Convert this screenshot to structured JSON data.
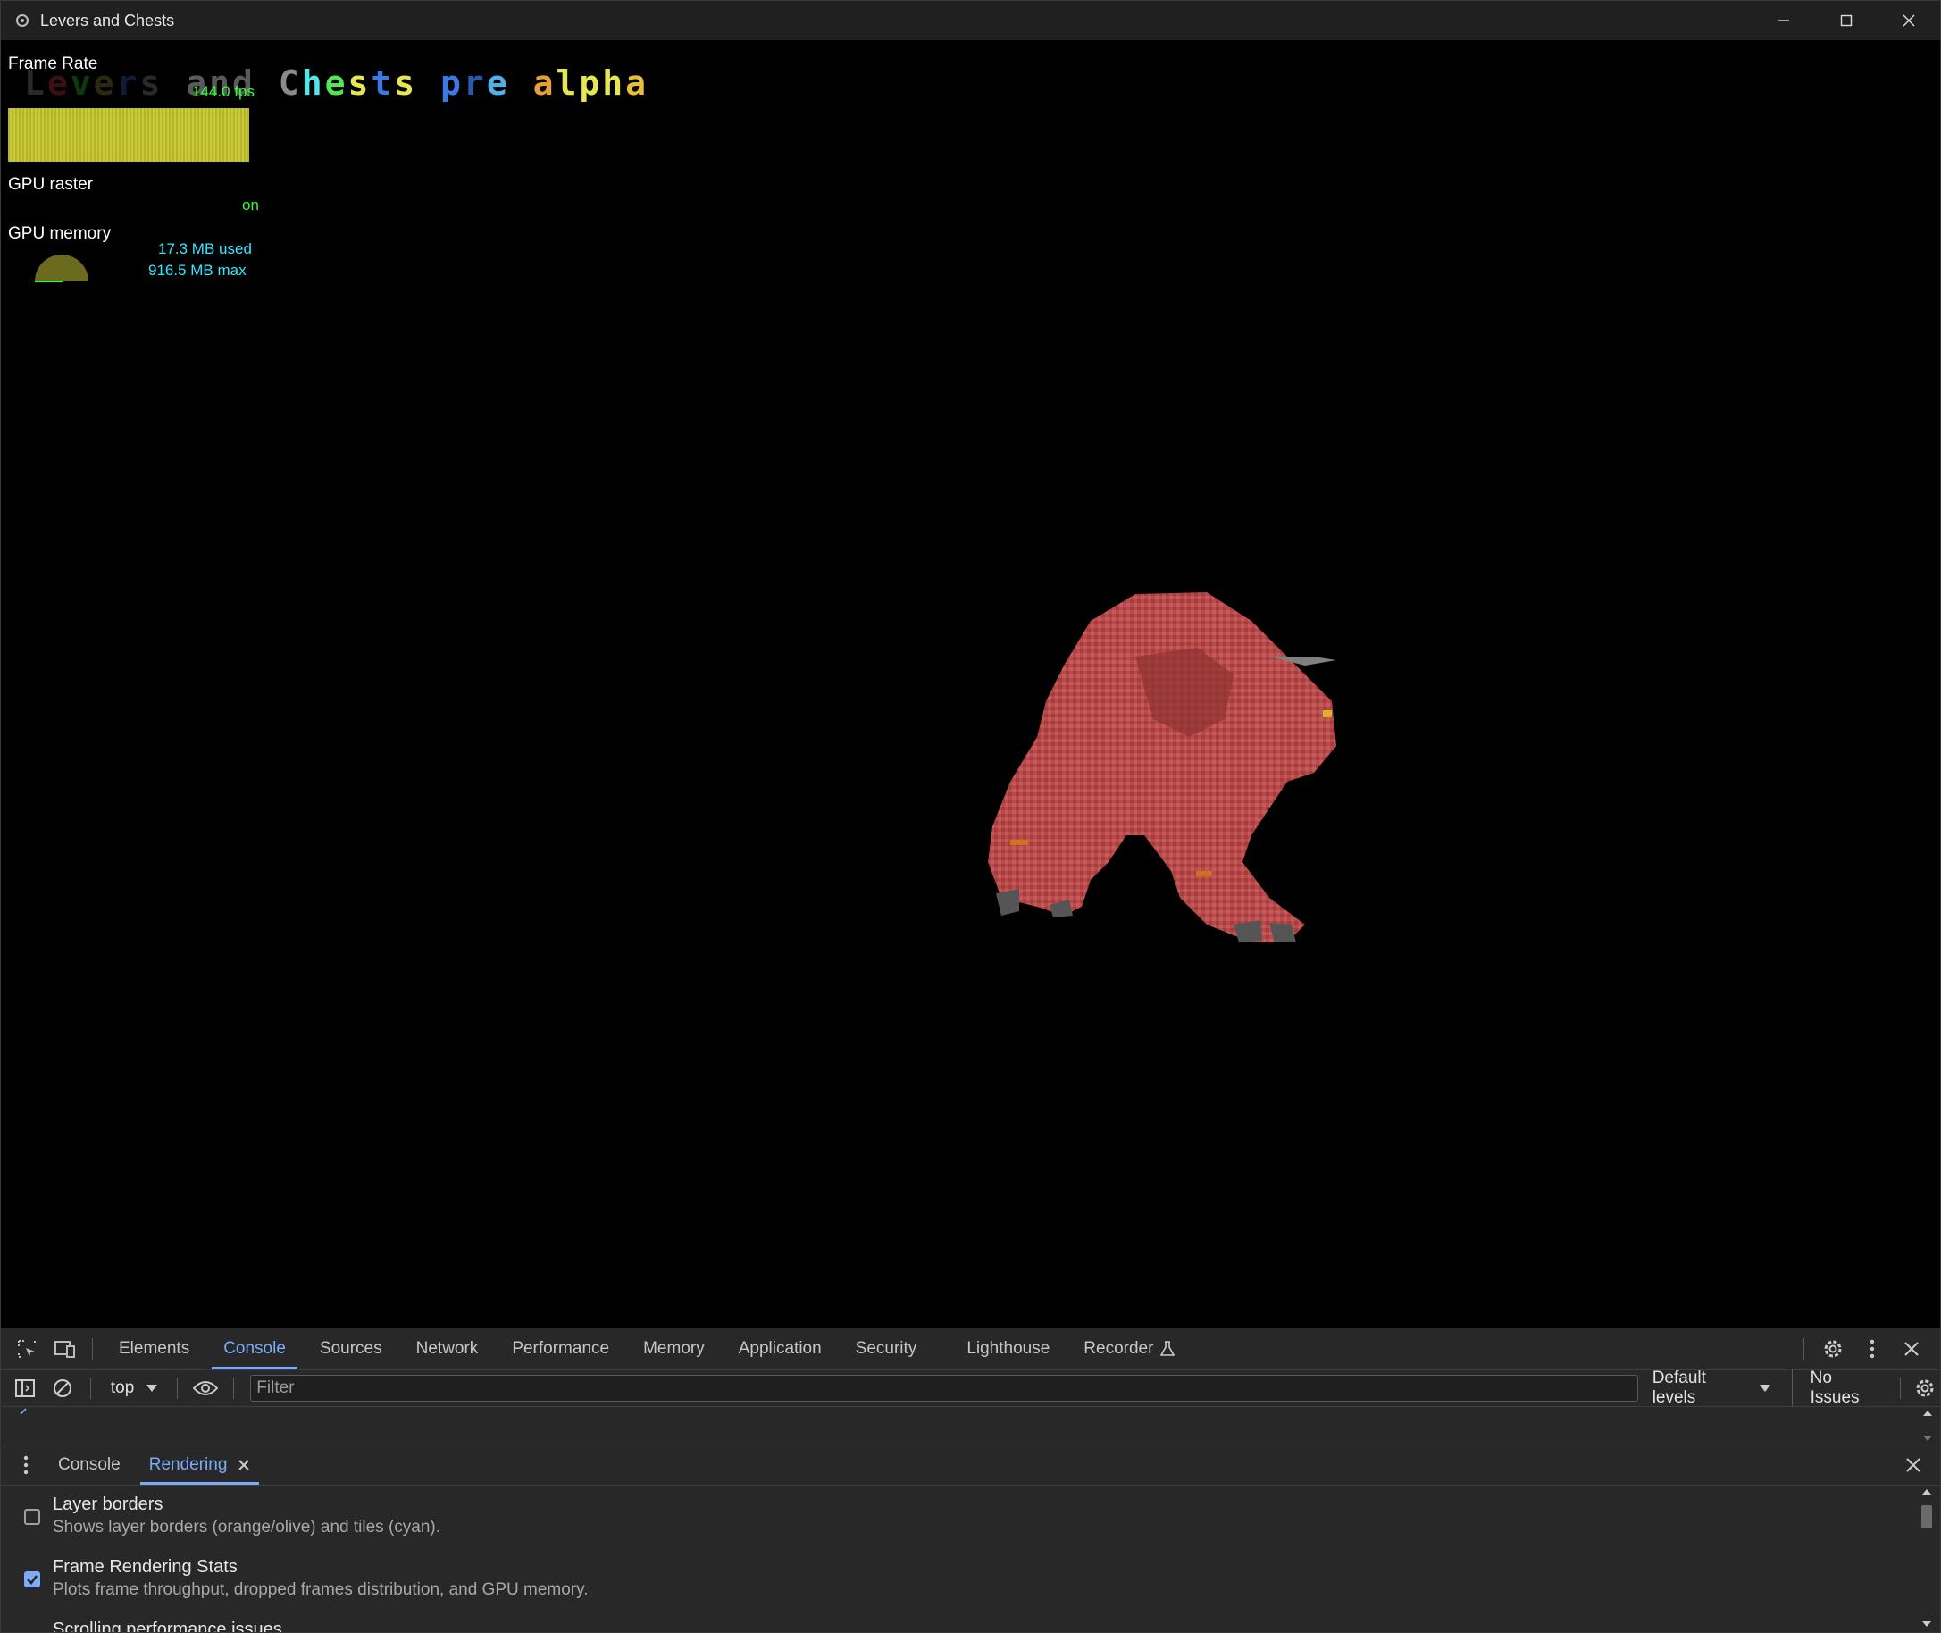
{
  "window": {
    "title": "Levers and Chests"
  },
  "hud": {
    "frame_rate_label": "Frame Rate",
    "fps": "144.0 fps",
    "gpu_raster_label": "GPU raster",
    "gpu_raster_value": "on",
    "gpu_memory_label": "GPU memory",
    "gpu_memory_used": "17.3 MB used",
    "gpu_memory_max": "916.5 MB max"
  },
  "game": {
    "title_letters": [
      {
        "ch": "L",
        "color": "#2a2a2a"
      },
      {
        "ch": "e",
        "color": "#3a1010"
      },
      {
        "ch": "v",
        "color": "#0d3a0d"
      },
      {
        "ch": "e",
        "color": "#2a2a10"
      },
      {
        "ch": "r",
        "color": "#101a3a"
      },
      {
        "ch": "s",
        "color": "#2a2a2a"
      },
      {
        "ch": " ",
        "color": "#000"
      },
      {
        "ch": "a",
        "color": "#5a5a5a"
      },
      {
        "ch": "n",
        "color": "#5a5a5a"
      },
      {
        "ch": "d",
        "color": "#5a5a5a"
      },
      {
        "ch": " ",
        "color": "#000"
      },
      {
        "ch": "C",
        "color": "#8a8a8a"
      },
      {
        "ch": "h",
        "color": "#52e6e6"
      },
      {
        "ch": "e",
        "color": "#52e652"
      },
      {
        "ch": "s",
        "color": "#e6e652"
      },
      {
        "ch": "t",
        "color": "#3a7ae6"
      },
      {
        "ch": "s",
        "color": "#e6e652"
      },
      {
        "ch": " ",
        "color": "#000"
      },
      {
        "ch": "p",
        "color": "#3a7ae6"
      },
      {
        "ch": "r",
        "color": "#2a5ab0"
      },
      {
        "ch": "e",
        "color": "#52b0e6"
      },
      {
        "ch": " ",
        "color": "#000"
      },
      {
        "ch": "a",
        "color": "#e6a03a"
      },
      {
        "ch": "l",
        "color": "#e6e652"
      },
      {
        "ch": "p",
        "color": "#e6e652"
      },
      {
        "ch": "h",
        "color": "#e6e652"
      },
      {
        "ch": "a",
        "color": "#e6c03a"
      }
    ]
  },
  "devtools": {
    "tabs": [
      "Elements",
      "Console",
      "Sources",
      "Network",
      "Performance",
      "Memory",
      "Application",
      "Security",
      "Lighthouse",
      "Recorder"
    ],
    "active_tab": "Console",
    "context": "top",
    "filter_placeholder": "Filter",
    "levels": "Default levels",
    "issues": "No Issues",
    "drawer_tabs": [
      "Console",
      "Rendering"
    ],
    "rendering_options": [
      {
        "title": "Layer borders",
        "desc": "Shows layer borders (orange/olive) and tiles (cyan).",
        "checked": false
      },
      {
        "title": "Frame Rendering Stats",
        "desc": "Plots frame throughput, dropped frames distribution, and GPU memory.",
        "checked": true
      },
      {
        "title": "Scrolling performance issues",
        "desc": "",
        "checked": false
      }
    ]
  },
  "colors": {
    "accent": "#7cacf8",
    "fps_green": "#33ff33",
    "mem_cyan": "#33e6ff",
    "fps_bar": "#c9c93a"
  }
}
